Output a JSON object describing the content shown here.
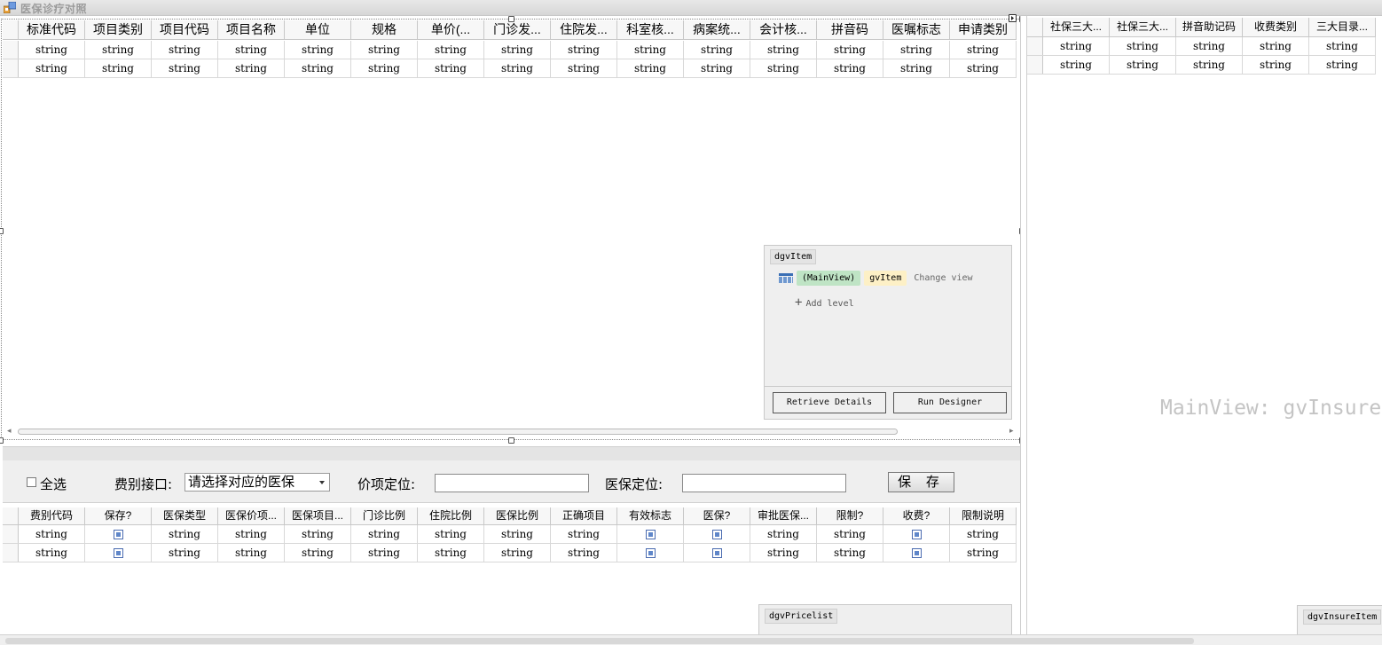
{
  "app": {
    "title": "医保诊疗对照"
  },
  "top_grid": {
    "columns": [
      "标准代码",
      "项目类别",
      "项目代码",
      "项目名称",
      "单位",
      "规格",
      "单价(...",
      "门诊发...",
      "住院发...",
      "科室核...",
      "病案统...",
      "会计核...",
      "拼音码",
      "医嘱标志",
      "申请类别"
    ],
    "rows": [
      [
        "string",
        "string",
        "string",
        "string",
        "string",
        "string",
        "string",
        "string",
        "string",
        "string",
        "string",
        "string",
        "string",
        "string",
        "string"
      ],
      [
        "string",
        "string",
        "string",
        "string",
        "string",
        "string",
        "string",
        "string",
        "string",
        "string",
        "string",
        "string",
        "string",
        "string",
        "string"
      ]
    ]
  },
  "designer_item": {
    "name": "dgvItem",
    "main_view": "(MainView)",
    "view_name": "gvItem",
    "change_view": "Change view",
    "add_level": "Add level",
    "retrieve_button": "Retrieve Details",
    "run_button": "Run Designer"
  },
  "toolbar": {
    "select_all": "全选",
    "fee_interface_label": "费别接口:",
    "fee_interface_value": "请选择对应的医保",
    "price_locate_label": "价项定位:",
    "insure_locate_label": "医保定位:",
    "save_label": "保 存"
  },
  "bottom_grid": {
    "columns": [
      "费别代码",
      "保存?",
      "医保类型",
      "医保价项...",
      "医保项目...",
      "门诊比例",
      "住院比例",
      "医保比例",
      "正确项目",
      "有效标志",
      "医保?",
      "审批医保...",
      "限制?",
      "收费?",
      "限制说明"
    ],
    "checkbox_columns": [
      1,
      9,
      10,
      13
    ],
    "rows": [
      [
        "string",
        "",
        "string",
        "string",
        "string",
        "string",
        "string",
        "string",
        "string",
        "",
        "",
        "string",
        "string",
        "",
        "string"
      ],
      [
        "string",
        "",
        "string",
        "string",
        "string",
        "string",
        "string",
        "string",
        "string",
        "",
        "",
        "string",
        "string",
        "",
        "string"
      ]
    ]
  },
  "designer_pricelist": {
    "name": "dgvPricelist"
  },
  "right_grid": {
    "columns": [
      "社保三大...",
      "社保三大...",
      "拼音助记码",
      "收费类别",
      "三大目录..."
    ],
    "rows": [
      [
        "string",
        "string",
        "string",
        "string",
        "string"
      ],
      [
        "string",
        "string",
        "string",
        "string",
        "string"
      ]
    ]
  },
  "right_watermark": "MainView: gvInsure",
  "designer_insure": {
    "name": "dgvInsureItem"
  }
}
